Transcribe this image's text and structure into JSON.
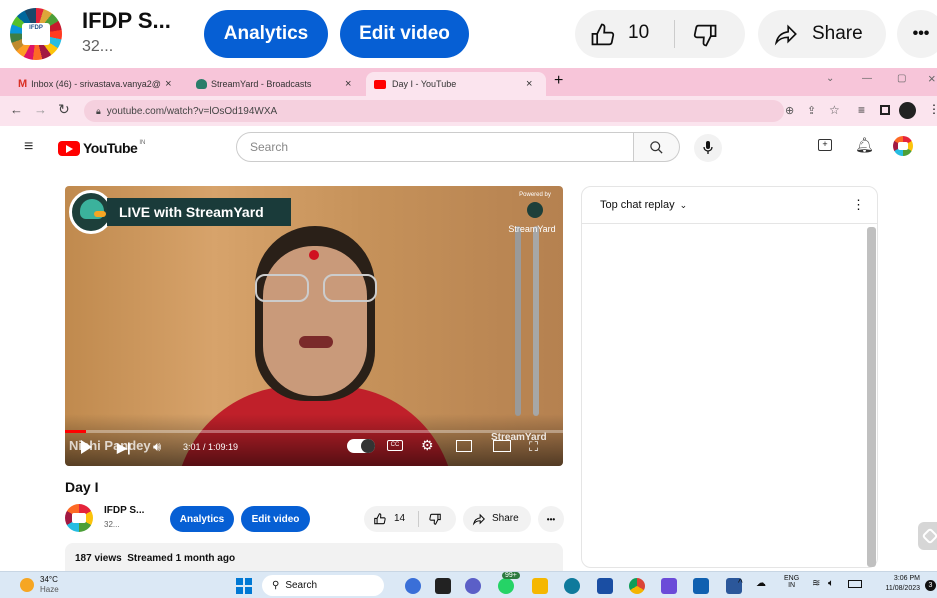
{
  "top_bar": {
    "channel_name": "IFDP S...",
    "subscriber_count": "32...",
    "logo_text": "IFDP",
    "analytics_label": "Analytics",
    "edit_video_label": "Edit video",
    "like_count": "10",
    "share_label": "Share",
    "more_label": "•••"
  },
  "browser": {
    "tabs": [
      {
        "label": "Inbox (46) - srivastava.vanya2@g",
        "icon": "gmail-icon"
      },
      {
        "label": "StreamYard - Broadcasts",
        "icon": "streamyard-icon"
      },
      {
        "label": "Day I - YouTube",
        "icon": "youtube-icon"
      }
    ],
    "url": "youtube.com/watch?v=lOsOd194WXA",
    "new_tab": "+",
    "tab_close": "×"
  },
  "youtube": {
    "brand": "YouTube",
    "region": "IN",
    "search_placeholder": "Search"
  },
  "video": {
    "overlay_title": "LIVE with StreamYard",
    "powered_by": "Powered by",
    "powered_brand": "StreamYard",
    "presenter_name": "Nishi Pandey",
    "time_current": "3:01",
    "time_total": "1:09:19",
    "time_display": "3:01 / 1:09:19",
    "progress_fraction": 0.043,
    "bottom_brand": "StreamYard"
  },
  "chat": {
    "header": "Top chat replay"
  },
  "below_video": {
    "title": "Day I",
    "channel_name": "IFDP S...",
    "subscriber_count": "32...",
    "analytics_label": "Analytics",
    "edit_video_label": "Edit video",
    "like_count": "14",
    "share_label": "Share",
    "more_label": "•••",
    "stats": "187 views  Streamed 1 month ago"
  },
  "taskbar": {
    "weather_temp": "34°C",
    "weather_desc": "Haze",
    "search_label": "Search",
    "badge": "99+",
    "lang_top": "ENG",
    "lang_bottom": "IN",
    "time": "3:06 PM",
    "date": "11/08/2023",
    "notif_count": "3"
  },
  "colors": {
    "accent_blue": "#065fd4",
    "youtube_red": "#ff0000",
    "tabstrip_pink": "#f7c5d9"
  }
}
